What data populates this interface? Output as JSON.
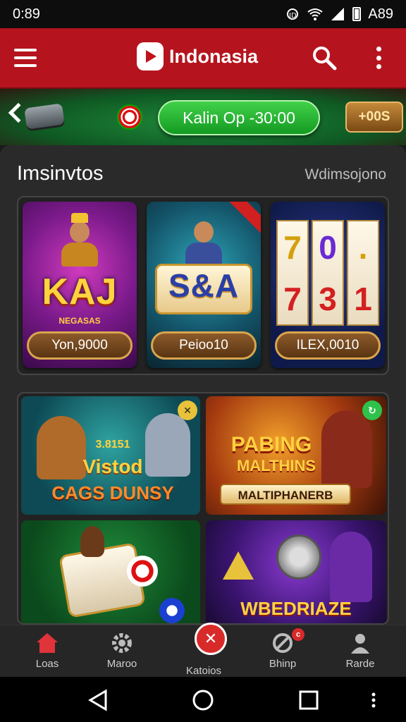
{
  "status": {
    "time": "0:89",
    "right_text": "A89"
  },
  "header": {
    "brand": "Indonasia",
    "icons": [
      "menu-icon",
      "search-icon",
      "more-vertical-icon"
    ]
  },
  "banner": {
    "balance_label": "Kalin Op -30:00",
    "coin_label": "+00S"
  },
  "section": {
    "title": "Imsinvtos",
    "link": "Wdimsojono"
  },
  "featured": [
    {
      "title": "KAJ",
      "subtitle": "NEGASAS",
      "button": "Yon,9000"
    },
    {
      "title": "S&A",
      "subtitle": "",
      "button": "Peioo10"
    },
    {
      "title": "",
      "reels_top": [
        "7",
        ".",
        "0"
      ],
      "reels_bottom": [
        "7",
        "3",
        "1"
      ],
      "button": "ILEX,0010"
    }
  ],
  "tiles": [
    {
      "line1": "3.8151",
      "line2": "Vistod",
      "line3": "CAGS DUNSY"
    },
    {
      "line1": "PABING",
      "line2": "MALTHINS",
      "line3": "MALTIPHANERB"
    },
    {
      "line1": ""
    },
    {
      "line1": "WBEDRIAZE"
    }
  ],
  "colors": {
    "primary": "#b5141e",
    "accent_green": "#1fa32c",
    "gold": "#d9a54e"
  },
  "bottom_nav": [
    {
      "label": "Loas",
      "icon": "home-icon"
    },
    {
      "label": "Maroo",
      "icon": "gear-icon"
    },
    {
      "label": "Katoios",
      "icon": "promo-icon"
    },
    {
      "label": "Bhinp",
      "icon": "edit-icon",
      "badge": "c"
    },
    {
      "label": "Rarde",
      "icon": "user-icon"
    }
  ]
}
